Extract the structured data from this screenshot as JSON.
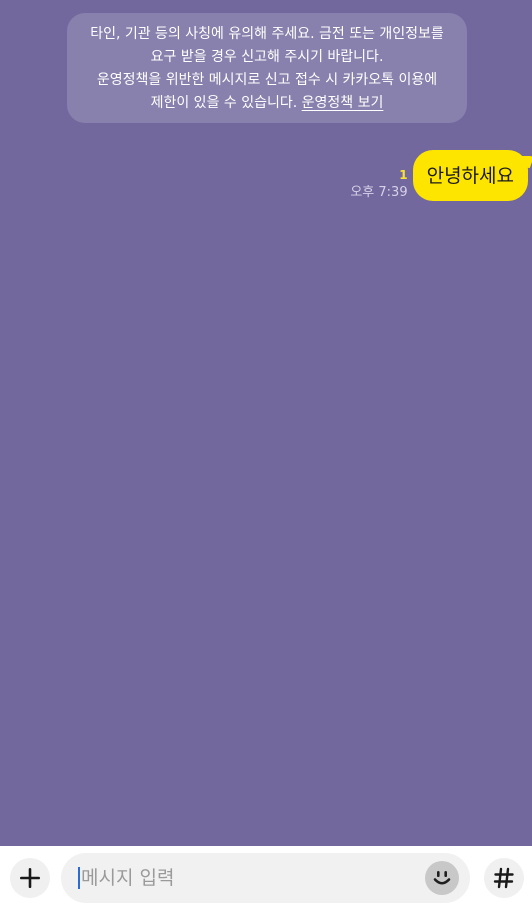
{
  "notice": {
    "line1": "타인, 기관 등의 사칭에 유의해 주세요. 금전 또는 개인정보를",
    "line2": "요구 받을 경우 신고해 주시기 바랍니다.",
    "line3": "운영정책을 위반한 메시지로 신고 접수 시 카카오톡 이용에",
    "line4_text": "제한이 있을 수 있습니다. ",
    "policy_link": "운영정책 보기"
  },
  "message": {
    "text": "안녕하세요",
    "unread_count": "1",
    "time": "오후 7:39"
  },
  "input": {
    "placeholder": "메시지 입력"
  },
  "icons": {
    "plus": "plus-icon",
    "emoji": "emoji-icon",
    "hash": "hashtag-icon"
  },
  "colors": {
    "background": "#72689e",
    "bubble": "#fee500",
    "unread": "#fbe32d"
  }
}
